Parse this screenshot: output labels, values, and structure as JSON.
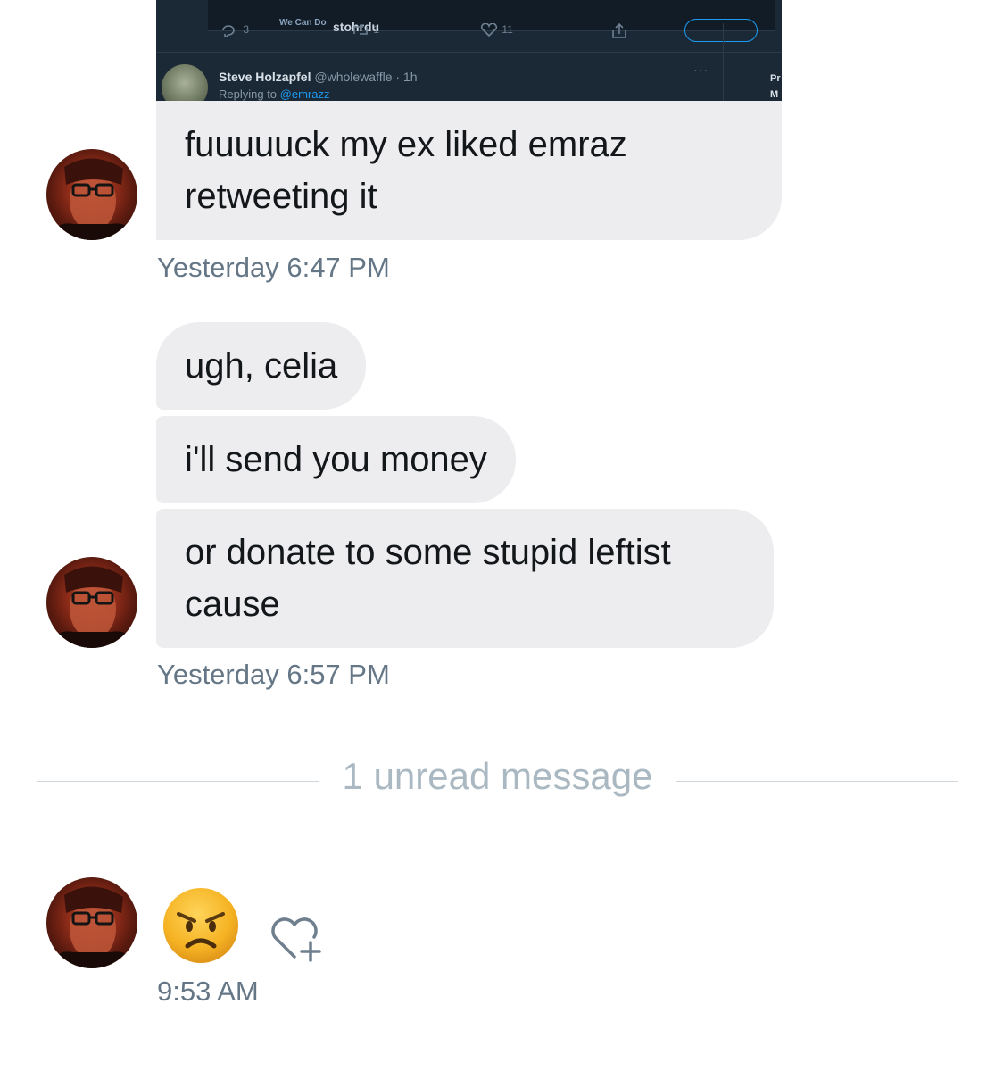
{
  "attached_image": {
    "card_logo": "We Can Do",
    "card_title": "stohrdu",
    "actions": {
      "replies": "3",
      "retweets": "1",
      "likes": "11"
    },
    "tweet": {
      "author_name": "Steve Holzapfel",
      "author_handle": "@wholewaffle · 1h",
      "reply_prefix": "Replying to",
      "reply_mention": "@emrazz",
      "more": "···"
    },
    "side_text": [
      "Pr",
      "M"
    ]
  },
  "messages": [
    {
      "text_line1": "fuuuuuck my ex liked emraz",
      "text_line2": "retweeting it"
    },
    {
      "text": "ugh, celia"
    },
    {
      "text": "i'll send you money"
    },
    {
      "text_line1": "or donate to some stupid leftist",
      "text_line2": "cause"
    }
  ],
  "timestamps": {
    "group1": "Yesterday 6:47 PM",
    "group2": "Yesterday 6:57 PM",
    "group3": "9:53 AM"
  },
  "unread_divider": "1 unread message",
  "reaction": {
    "emoji_icon": "angry-face-emoji",
    "add_reaction_icon": "heart-plus-icon"
  },
  "colors": {
    "bubble_bg": "#ededef",
    "text": "#14171a",
    "timestamp": "#657786",
    "divider_text": "#aab8c2",
    "media_bg": "#1b2836",
    "link": "#1d9bf0"
  }
}
